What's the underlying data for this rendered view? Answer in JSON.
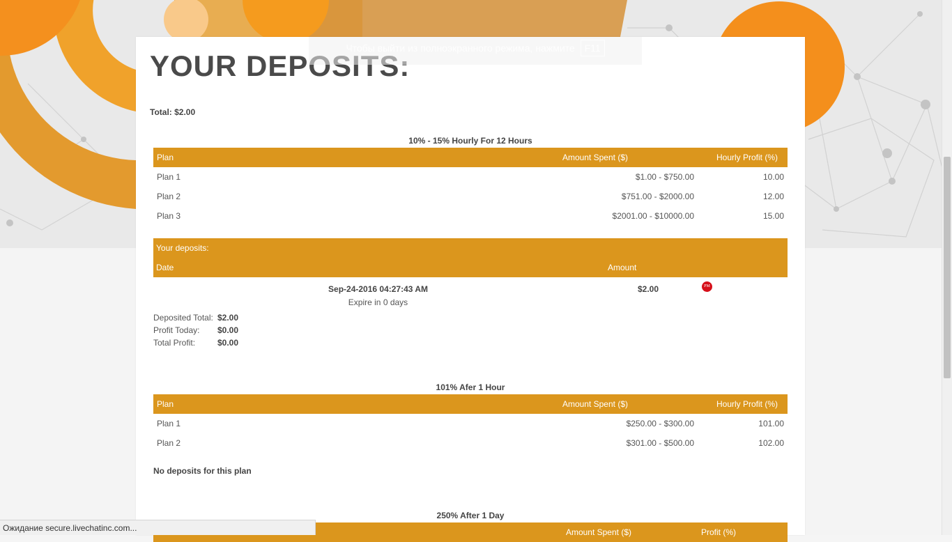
{
  "fullscreen_hint": {
    "text": "Чтобы выйти из полноэкранного режима, нажмите",
    "key": "F11"
  },
  "page_title": "YOUR DEPOSITS:",
  "total": "Total: $2.00",
  "headers": {
    "plan": "Plan",
    "amount_spent": "Amount Spent ($)",
    "hourly_profit": "Hourly Profit (%)",
    "profit": "Profit (%)"
  },
  "sections": [
    {
      "title": "10% - 15% Hourly For 12 Hours",
      "rows": [
        {
          "plan": "Plan 1",
          "amount": "$1.00 - $750.00",
          "profit": "10.00"
        },
        {
          "plan": "Plan 2",
          "amount": "$751.00 - $2000.00",
          "profit": "12.00"
        },
        {
          "plan": "Plan 3",
          "amount": "$2001.00 - $10000.00",
          "profit": "15.00"
        }
      ],
      "deposits": {
        "label": "Your deposits:",
        "date_header": "Date",
        "amount_header": "Amount",
        "items": [
          {
            "date": "Sep-24-2016 04:27:43 AM",
            "expire": "Expire in 0 days",
            "amount": "$2.00",
            "badge": "PM"
          }
        ],
        "summary": [
          {
            "label": "Deposited Total:",
            "value": "$2.00"
          },
          {
            "label": "Profit Today:",
            "value": "$0.00"
          },
          {
            "label": "Total Profit:",
            "value": "$0.00"
          }
        ]
      }
    },
    {
      "title": "101% Afer 1 Hour",
      "rows": [
        {
          "plan": "Plan 1",
          "amount": "$250.00 - $300.00",
          "profit": "101.00"
        },
        {
          "plan": "Plan 2",
          "amount": "$301.00 - $500.00",
          "profit": "102.00"
        }
      ],
      "no_deposits": "No deposits for this plan"
    },
    {
      "title": "250% After 1 Day"
    }
  ],
  "status_bar": "Ожидание secure.livechatinc.com...",
  "colors": {
    "accent": "#db961d",
    "pm_badge": "#d6101a"
  }
}
